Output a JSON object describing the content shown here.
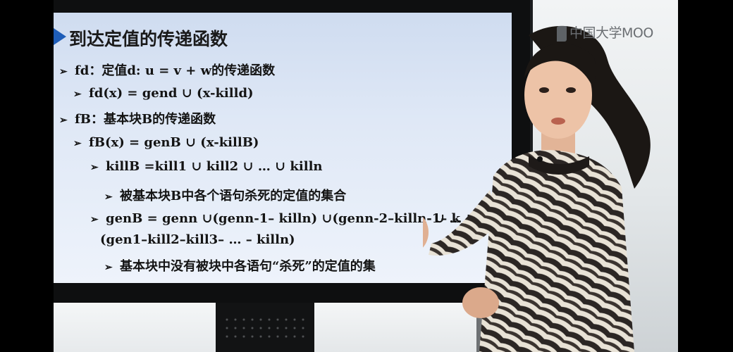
{
  "logo": {
    "mark": "logo-mark",
    "text": "中国大学MOO"
  },
  "slide": {
    "title": "到达定值的传递函数",
    "lines": [
      "fd：定值d: u = v + w的传递函数",
      "fd(x) = gend ∪ (x-killd)",
      "fB：基本块B的传递函数",
      "fB(x) = genB ∪ (x-killB)",
      "killB =kill1 ∪ kill2 ∪ … ∪ killn",
      "被基本块B中各个语句杀死的定值的集合",
      "genB = genn ∪(genn-1– killn) ∪(genn-2–killn-1– k",
      "∪ … ∪",
      "(gen1–kill2–kill3– … – killn)",
      "基本块中没有被块中各语句“杀死”的定值的集"
    ]
  },
  "colors": {
    "title_arrow": "#1e5db8",
    "screen": "#dfe8f6",
    "presenter_top": "#2b2b2b"
  }
}
